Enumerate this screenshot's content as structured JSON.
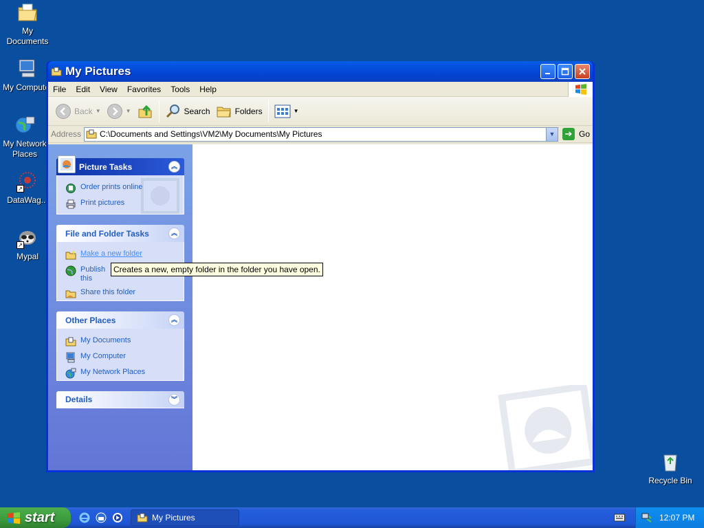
{
  "desktop": {
    "icons": [
      {
        "label": "My Documents"
      },
      {
        "label": "My Computer"
      },
      {
        "label": "My Network Places"
      },
      {
        "label": "DataWag..."
      },
      {
        "label": "Mypal"
      },
      {
        "label": "Recycle Bin"
      }
    ]
  },
  "window": {
    "title": "My Pictures",
    "menu": [
      "File",
      "Edit",
      "View",
      "Favorites",
      "Tools",
      "Help"
    ],
    "toolbar": {
      "back": "Back",
      "search": "Search",
      "folders": "Folders"
    },
    "address": {
      "label": "Address",
      "path": "C:\\Documents and Settings\\VM2\\My Documents\\My Pictures",
      "go": "Go"
    }
  },
  "taskpane": {
    "picture_tasks": {
      "title": "Picture Tasks",
      "items": [
        "Order prints online",
        "Print pictures"
      ]
    },
    "file_folder_tasks": {
      "title": "File and Folder Tasks",
      "items": [
        "Make a new folder",
        "Publish this folder to the Web",
        "Share this folder"
      ]
    },
    "other_places": {
      "title": "Other Places",
      "items": [
        "My Documents",
        "My Computer",
        "My Network Places"
      ]
    },
    "details": {
      "title": "Details"
    }
  },
  "tooltip": "Creates a new, empty folder in the folder you have open.",
  "taskbar": {
    "start": "start",
    "task": "My Pictures",
    "clock": "12:07 PM"
  }
}
